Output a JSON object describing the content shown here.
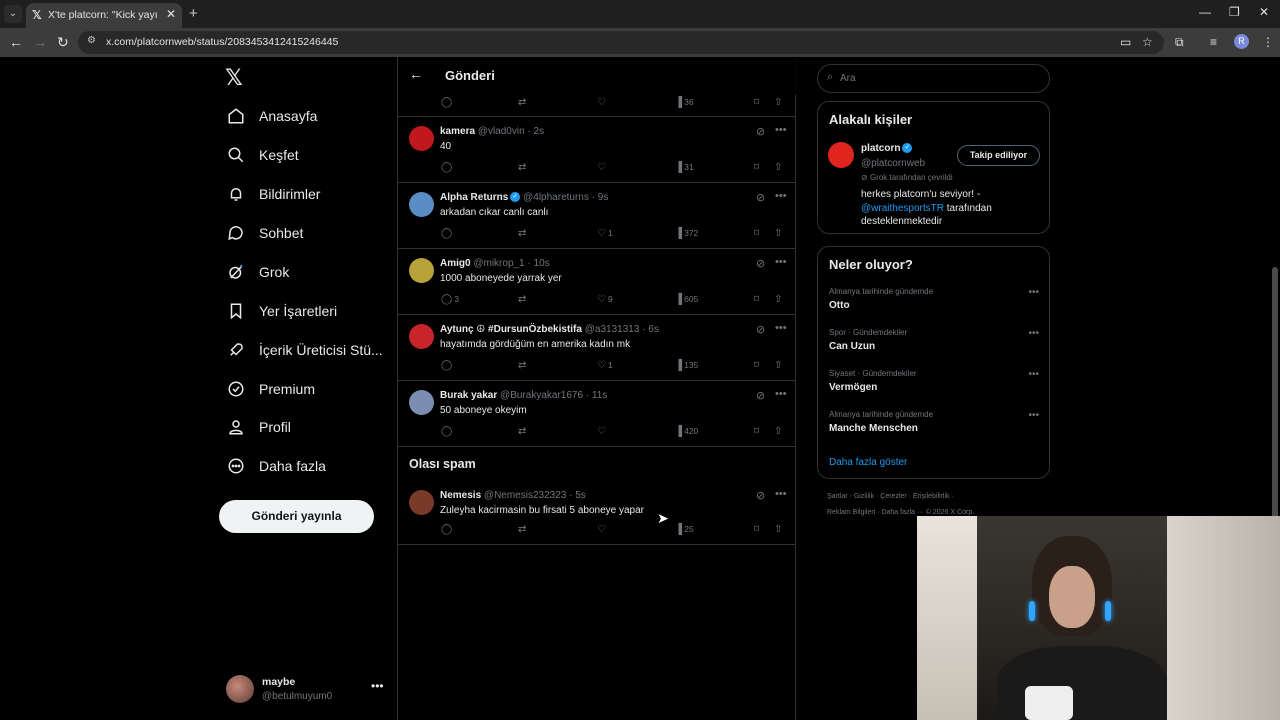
{
  "browser": {
    "tab_title": "X'te platcorn: \"Kick yayıncısı Ad",
    "url": "x.com/platcornweb/status/2083453412415246445"
  },
  "sidebar": {
    "items": [
      {
        "label": "Anasayfa",
        "icon": "home-icon"
      },
      {
        "label": "Keşfet",
        "icon": "search-icon"
      },
      {
        "label": "Bildirimler",
        "icon": "bell-icon"
      },
      {
        "label": "Sohbet",
        "icon": "chat-icon"
      },
      {
        "label": "Grok",
        "icon": "grok-icon"
      },
      {
        "label": "Yer İşaretleri",
        "icon": "bookmark-icon"
      },
      {
        "label": "İçerik Üreticisi Stü...",
        "icon": "rocket-icon"
      },
      {
        "label": "Premium",
        "icon": "verified-icon"
      },
      {
        "label": "Profil",
        "icon": "person-icon"
      },
      {
        "label": "Daha fazla",
        "icon": "more-circle-icon"
      }
    ],
    "post_button": "Gönderi yayınla",
    "me": {
      "name": "maybe",
      "handle": "@betulmuyum0"
    }
  },
  "main": {
    "header_title": "Gönderi",
    "first_views": "36",
    "replies": [
      {
        "name": "kamera",
        "handle": "@vlad0vin",
        "time": "2s",
        "text": "40",
        "replies": "",
        "likes": "",
        "views": "31",
        "verified": false,
        "avatar_color": "#c0181c"
      },
      {
        "name": "Alpha Returns",
        "handle": "@4lphareturns",
        "time": "9s",
        "text": "arkadan cıkar canlı canlı",
        "replies": "",
        "likes": "1",
        "views": "372",
        "verified": true,
        "avatar_color": "#5c8cc4"
      },
      {
        "name": "Amig0",
        "handle": "@mikrop_1",
        "time": "10s",
        "text": "1000 aboneyede yarrak yer",
        "replies": "3",
        "likes": "9",
        "views": "605",
        "verified": false,
        "avatar_color": "#b8a23a"
      },
      {
        "name": "Aytunç ☮ #DursunÖzbekistifa",
        "handle": "@a3131313",
        "time": "6s",
        "text": "hayatımda gördüğüm en amerika kadın mk",
        "replies": "",
        "likes": "1",
        "views": "135",
        "verified": false,
        "avatar_color": "#c8242c"
      },
      {
        "name": "Burak yakar",
        "handle": "@Burakyakar1676",
        "time": "11s",
        "text": "50 aboneye okeyim",
        "replies": "",
        "likes": "",
        "views": "420",
        "verified": false,
        "avatar_color": "#7b8db0"
      }
    ],
    "spam_title": "Olası spam",
    "spam_reply": {
      "name": "Nemesis",
      "handle": "@Nemesis232323",
      "time": "5s",
      "text": "Zuleyha kacirmasin bu firsati 5 aboneye yapar",
      "views": "25",
      "avatar_color": "#7a3a2a"
    }
  },
  "right": {
    "search_placeholder": "Ara",
    "related": {
      "title": "Alakalı kişiler",
      "name": "platcorn",
      "handle": "@platcornweb",
      "grok_note": "Grok tarafından çevrildi",
      "follow_label": "Takip ediliyor",
      "bio_before": "herkes platcorn'u seviyor! -",
      "bio_link": "@wraithesportsTR",
      "bio_after": "tarafından desteklenmektedir"
    },
    "trends": {
      "title": "Neler oluyor?",
      "items": [
        {
          "category": "Almanya tarihinde gündemde",
          "name": "Otto"
        },
        {
          "category": "Spor · Gündemdekiler",
          "name": "Can Uzun"
        },
        {
          "category": "Siyaset · Gündemdekiler",
          "name": "Vermögen"
        },
        {
          "category": "Almanya tarihinde gündemde",
          "name": "Manche Menschen"
        }
      ],
      "show_more": "Daha fazla göster"
    },
    "footer_line1": "Şartlar   ·   Gizlilik   ·   Çerezler   ·   Erişilebilirlik   ·",
    "footer_line2": "Reklam Bilgileri   ·   Daha fazla ···   © 2026 X Corp."
  }
}
